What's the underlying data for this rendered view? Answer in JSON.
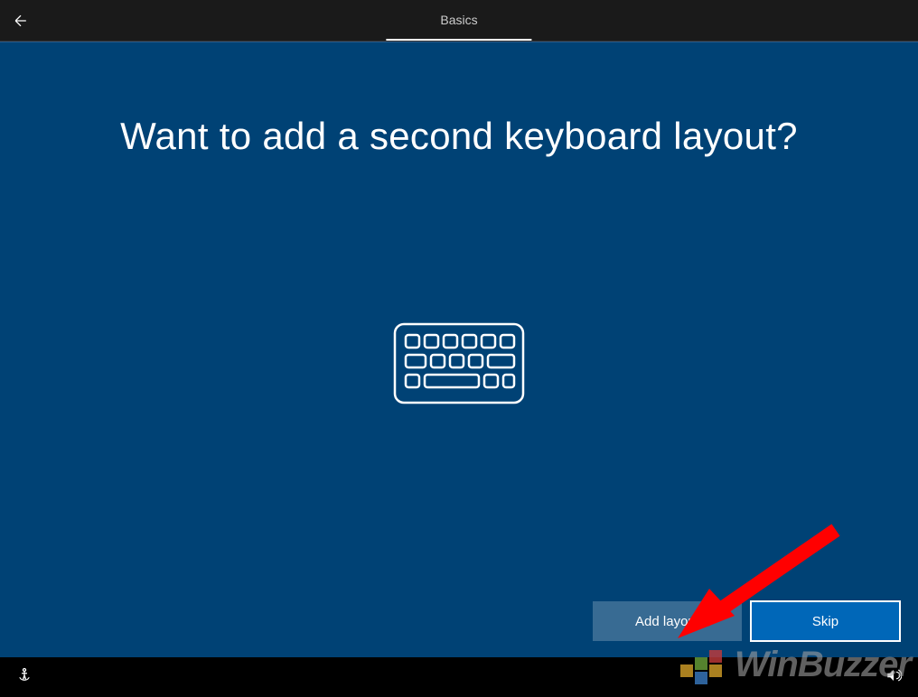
{
  "header": {
    "tab_label": "Basics"
  },
  "main": {
    "title": "Want to add a second keyboard layout?"
  },
  "buttons": {
    "add_layout": "Add layout",
    "skip": "Skip"
  },
  "watermark": {
    "text": "WinBuzzer"
  }
}
